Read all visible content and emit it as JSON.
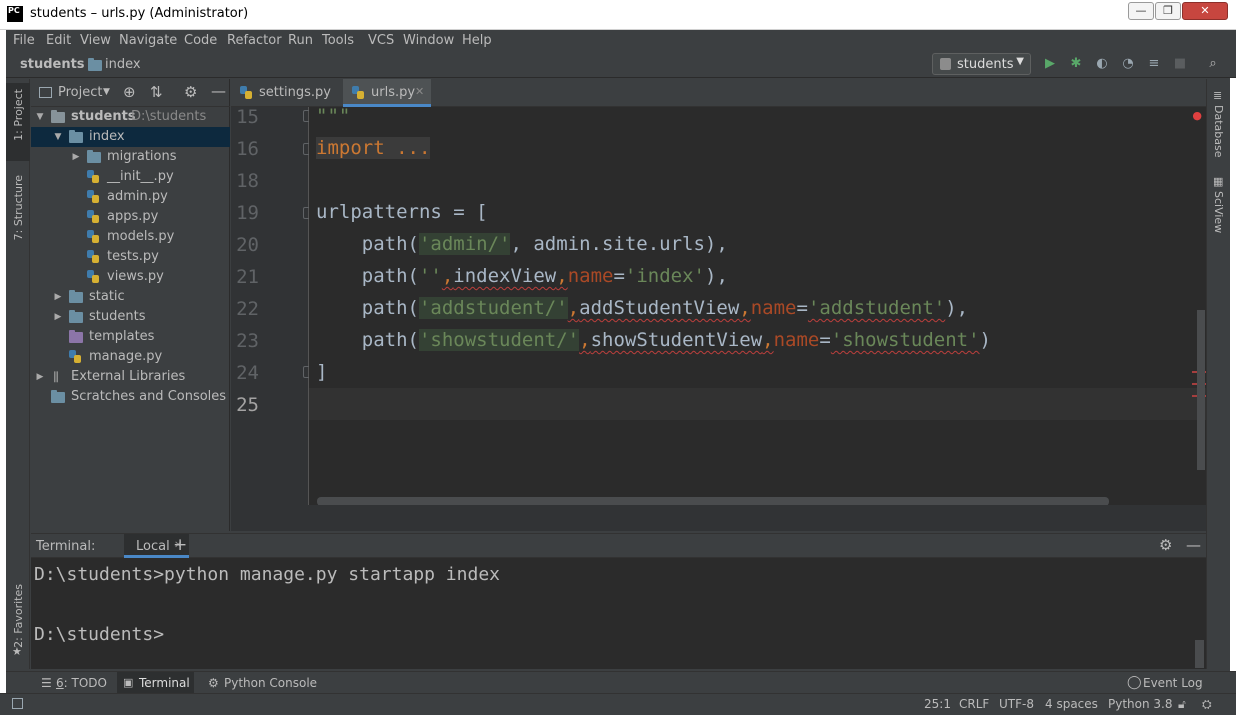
{
  "window": {
    "title": "students – urls.py (Administrator)",
    "logo": "PC",
    "controls": {
      "minimize": "—",
      "maximize": "❐",
      "close": "✕"
    }
  },
  "menu": [
    "File",
    "Edit",
    "View",
    "Navigate",
    "Code",
    "Refactor",
    "Run",
    "Tools",
    "VCS",
    "Window",
    "Help"
  ],
  "breadcrumb": {
    "project": "students",
    "folder": "index"
  },
  "run_config": {
    "name": "students"
  },
  "left_tool_tabs": {
    "project": "1: Project",
    "structure": "7: Structure",
    "favorites": "2: Favorites"
  },
  "right_tool_tabs": {
    "database": "Database",
    "sciview": "SciView"
  },
  "project_panel": {
    "title": "Project",
    "tree": [
      {
        "label": "students",
        "hint": "D:\\students",
        "depth": 0,
        "expanded": true,
        "kind": "folder"
      },
      {
        "label": "index",
        "depth": 1,
        "expanded": true,
        "kind": "folder",
        "selected": true
      },
      {
        "label": "migrations",
        "depth": 2,
        "expanded": false,
        "kind": "folder"
      },
      {
        "label": "__init__.py",
        "depth": 2,
        "kind": "py"
      },
      {
        "label": "admin.py",
        "depth": 2,
        "kind": "py"
      },
      {
        "label": "apps.py",
        "depth": 2,
        "kind": "py"
      },
      {
        "label": "models.py",
        "depth": 2,
        "kind": "py"
      },
      {
        "label": "tests.py",
        "depth": 2,
        "kind": "py"
      },
      {
        "label": "views.py",
        "depth": 2,
        "kind": "py"
      },
      {
        "label": "static",
        "depth": 1,
        "expanded": false,
        "kind": "folder"
      },
      {
        "label": "students",
        "depth": 1,
        "expanded": false,
        "kind": "folder"
      },
      {
        "label": "templates",
        "depth": 1,
        "kind": "folder-purple"
      },
      {
        "label": "manage.py",
        "depth": 1,
        "kind": "py"
      },
      {
        "label": "External Libraries",
        "depth": 0,
        "expanded": false,
        "kind": "lib"
      },
      {
        "label": "Scratches and Consoles",
        "depth": 0,
        "kind": "scratch"
      }
    ]
  },
  "editor_tabs": [
    {
      "label": "settings.py",
      "active": false
    },
    {
      "label": "urls.py",
      "active": true
    }
  ],
  "code": {
    "line_numbers": [
      "15",
      "16",
      "18",
      "19",
      "20",
      "21",
      "22",
      "23",
      "24",
      "25"
    ],
    "lines": {
      "l15": "\"\"\"",
      "l16": "import ...",
      "l19": "urlpatterns = [",
      "l20": {
        "a": "    path(",
        "s1": "'admin/'",
        "b": ", admin.site.urls),"
      },
      "l21": {
        "a": "    path(",
        "s1": "''",
        "c": ",",
        "v": "indexView",
        "d": ",",
        "p": "name",
        "e": "=",
        "s2": "'index'",
        "f": "),"
      },
      "l22": {
        "a": "    path(",
        "s1": "'addstudent/'",
        "c": ",",
        "v": "addStudentView",
        "d": ",",
        "p": "name",
        "e": "=",
        "s2": "'addstudent'",
        "f": "),"
      },
      "l23": {
        "a": "    path(",
        "s1": "'showstudent/'",
        "c": ",",
        "v": "showStudentView",
        "d": ",",
        "p": "name",
        "e": "=",
        "s2": "'showstudent'",
        "f": ")"
      },
      "l24": "]"
    }
  },
  "terminal": {
    "label": "Terminal:",
    "tab": "Local",
    "lines": [
      "D:\\students>python manage.py startapp index",
      "D:\\students>"
    ]
  },
  "bottom_tools": [
    {
      "key": "6",
      "label": ": TODO"
    },
    {
      "label": "Terminal"
    },
    {
      "label": "Python Console"
    }
  ],
  "event_log": "Event Log",
  "status": {
    "position": "25:1",
    "line_sep": "CRLF",
    "encoding": "UTF-8",
    "indent": "4 spaces",
    "interpreter": "Python 3.8"
  }
}
